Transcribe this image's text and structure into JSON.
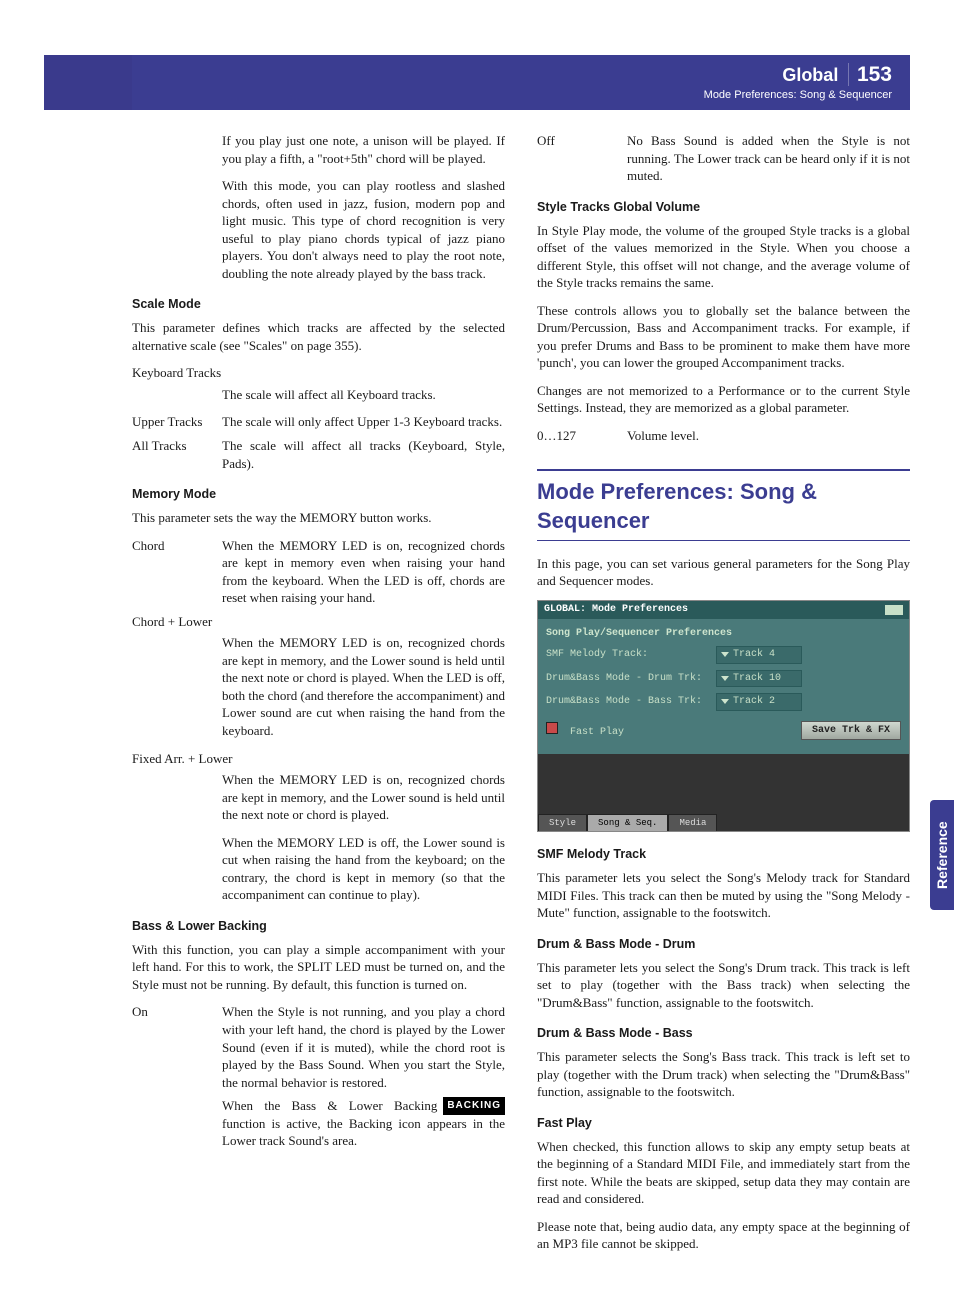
{
  "header": {
    "title": "Global",
    "page": "153",
    "subtitle": "Mode Preferences: Song & Sequencer"
  },
  "sideTab": "Reference",
  "left": {
    "intro1": "If you play just one note, a unison will be played. If you play a fifth, a \"root+5th\" chord will be played.",
    "intro2": "With this mode, you can play rootless and slashed chords, often used in jazz, fusion, modern pop and light music. This type of chord recognition is very useful to play piano chords typical of jazz piano players. You don't always need to play the root note, doubling the note already played by the bass track.",
    "scaleMode": {
      "head": "Scale Mode",
      "p1": "This parameter defines which tracks are affected by the selected alternative scale (see \"Scales\" on page 355).",
      "kbLabel": "Keyboard Tracks",
      "kbDesc": "The scale will affect all Keyboard tracks.",
      "upLabel": "Upper Tracks",
      "upDesc": "The scale will only affect Upper 1-3 Keyboard tracks.",
      "allLabel": "All Tracks",
      "allDesc": "The scale will affect all tracks (Keyboard, Style, Pads)."
    },
    "memoryMode": {
      "head": "Memory Mode",
      "p1": "This parameter sets the way the MEMORY button works.",
      "chordLabel": "Chord",
      "chordDesc": "When the MEMORY LED is on, recognized chords are kept in memory even when raising your hand from the keyboard. When the LED is off, chords are reset when raising your hand.",
      "clLabel": "Chord + Lower",
      "clDesc": "When the MEMORY LED is on, recognized chords are kept in memory, and the Lower sound is held until the next note or chord is played. When the LED is off, both the chord (and therefore the accompaniment) and Lower sound are cut when raising the hand from the keyboard.",
      "falLabel": "Fixed Arr. + Lower",
      "falDesc1": "When the MEMORY LED is on, recognized chords are kept in memory, and the Lower sound is held until the next note or chord is played.",
      "falDesc2": "When the MEMORY LED is off, the Lower sound is cut when raising the hand from the keyboard; on the contrary, the chord is kept in memory (so that the accompaniment can continue to play)."
    },
    "bassLower": {
      "head": "Bass & Lower Backing",
      "p1": "With this function, you can play a simple accompaniment with your left hand. For this to work, the SPLIT LED must be turned on, and the Style must not be running. By default, this function is turned on.",
      "onLabel": "On",
      "onDesc": "When the Style is not running, and you play a chord with your left hand, the chord is played by the Lower Sound (even if it is muted), while the chord root is played by the Bass Sound. When you start the Style, the normal behavior is restored.",
      "backingBadge": "BACKING",
      "onDesc2": "When the Bass & Lower Backing function is active, the Backing icon appears in the Lower track Sound's area."
    }
  },
  "right": {
    "offLabel": "Off",
    "offDesc": "No Bass Sound is added when the Style is not running. The Lower track can be heard only if it is not muted.",
    "stgv": {
      "head": "Style Tracks Global Volume",
      "p1": "In Style Play mode, the volume of the grouped Style tracks is a global offset of the values memorized in the Style. When you choose a different Style, this offset will not change, and the average volume of the Style tracks remains the same.",
      "p2": "These controls allows you to globally set the balance between the Drum/Percussion, Bass and Accompaniment tracks. For example, if you prefer Drums and Bass to be prominent to make them have more 'punch', you can lower the grouped Accompaniment tracks.",
      "p3": "Changes are not memorized to a Performance or to the current Style Settings. Instead, they are memorized as a global parameter.",
      "rangeLabel": "0…127",
      "rangeDesc": "Volume level."
    },
    "sectionTitle": "Mode Preferences: Song & Sequencer",
    "sectionIntro": "In this page, you can set various general parameters for the Song Play and Sequencer modes.",
    "screenshot": {
      "title": "GLOBAL: Mode Preferences",
      "section": "Song Play/Sequencer Preferences",
      "row1Label": "SMF Melody Track:",
      "row1Value": "Track 4",
      "row2Label": "Drum&Bass Mode - Drum Trk:",
      "row2Value": "Track 10",
      "row3Label": "Drum&Bass Mode - Bass Trk:",
      "row3Value": "Track 2",
      "fastPlay": "Fast Play",
      "saveBtn": "Save Trk & FX",
      "tab1": "Style",
      "tab2": "Song & Seq.",
      "tab3": "Media"
    },
    "smf": {
      "head": "SMF Melody Track",
      "p1": "This parameter lets you select the Song's Melody track for Standard MIDI Files. This track can then be muted by using the \"Song Melody - Mute\" function, assignable to the footswitch."
    },
    "dbDrum": {
      "head": "Drum & Bass Mode - Drum",
      "p1": "This parameter lets you select the Song's Drum track. This track is left set to play (together with the Bass track) when selecting the \"Drum&Bass\" function, assignable to the footswitch."
    },
    "dbBass": {
      "head": "Drum & Bass Mode - Bass",
      "p1": "This parameter selects the Song's Bass track. This track is left set to play (together with the Drum track) when selecting the \"Drum&Bass\" function, assignable to the footswitch."
    },
    "fastPlay": {
      "head": "Fast Play",
      "p1": "When checked, this function allows to skip any empty setup beats at the beginning of a Standard MIDI File, and immediately start from the first note. While the beats are skipped, setup data they may contain are read and considered.",
      "p2": "Please note that, being audio data, any empty space at the beginning of an MP3 file cannot be skipped."
    }
  }
}
